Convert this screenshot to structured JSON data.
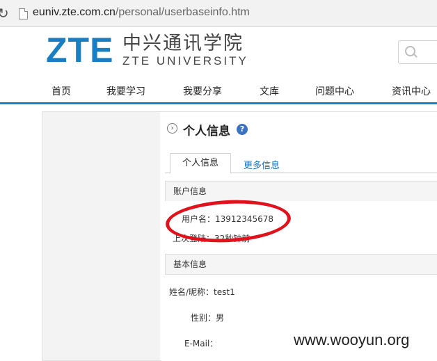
{
  "browser": {
    "url_host": "euniv.zte.com.cn",
    "url_path": "/personal/userbaseinfo.htm"
  },
  "header": {
    "logo": "ZTE",
    "brand_cn": "中兴通讯学院",
    "brand_en": "ZTE UNIVERSITY"
  },
  "nav": {
    "items": [
      "首页",
      "我要学习",
      "我要分享",
      "文库",
      "问题中心",
      "资讯中心"
    ]
  },
  "page": {
    "title": "个人信息",
    "help": "?",
    "tabs": [
      "个人信息",
      "更多信息"
    ],
    "sections": {
      "account": {
        "title": "账户信息",
        "username_label": "用户名：",
        "username_value": "13912345678",
        "last_login_label": "上次登陆：",
        "last_login_value": "32秒钟前"
      },
      "basic": {
        "title": "基本信息",
        "nickname_label": "姓名/昵称：",
        "nickname_value": "test1",
        "gender_label": "性别：",
        "gender_value": "男",
        "email_label": "E-Mail："
      }
    }
  },
  "watermark": "www.wooyun.org",
  "colors": {
    "brand": "#1a7ec3",
    "highlight": "#e0121b",
    "link": "#1a6fb5"
  }
}
